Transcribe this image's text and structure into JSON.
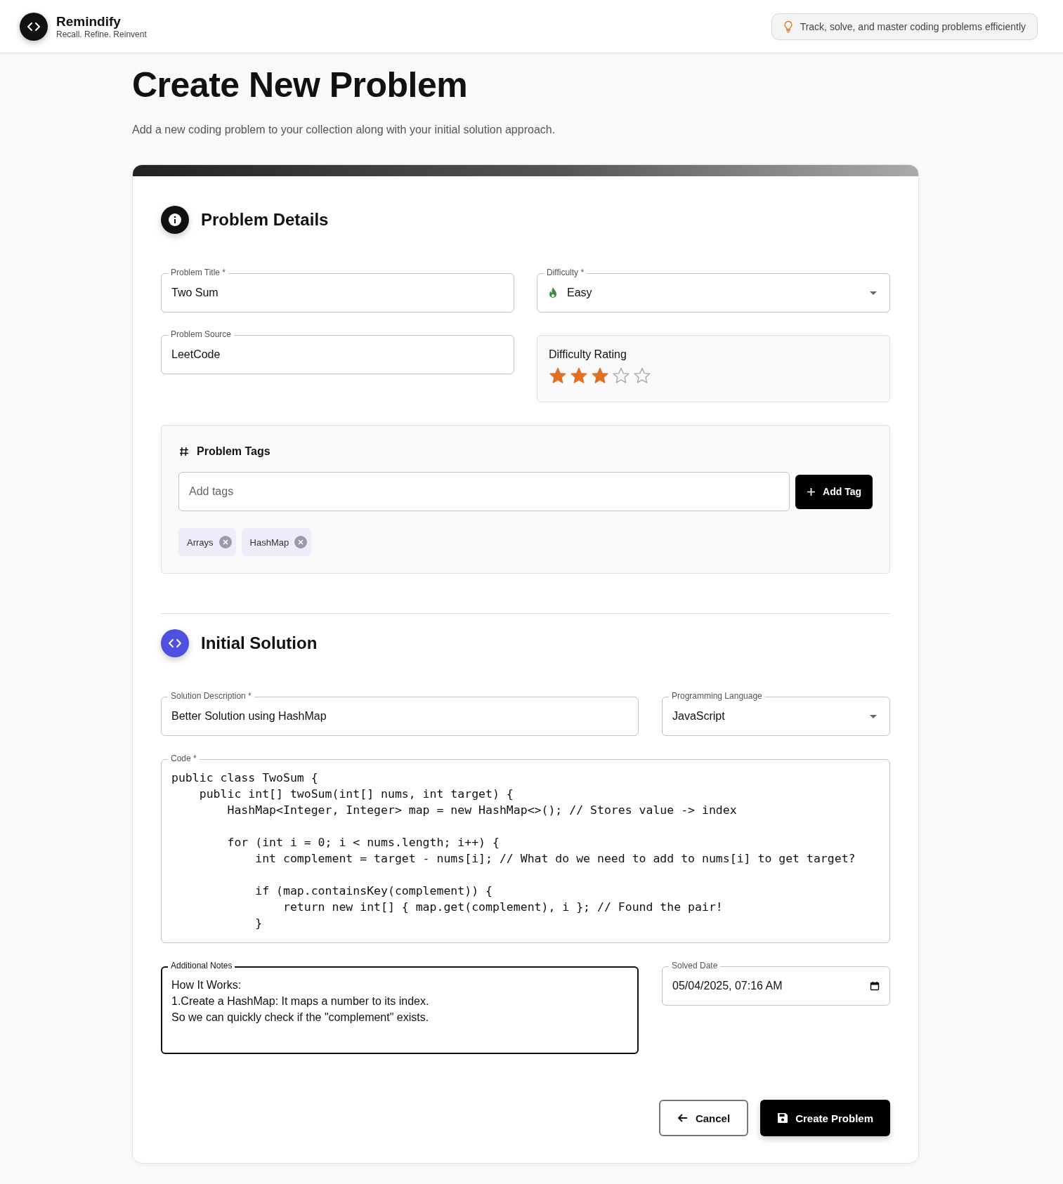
{
  "header": {
    "brand": "Remindify",
    "tagline": "Recall. Refine. Reinvent",
    "tip": "Track, solve, and master coding problems efficiently"
  },
  "page": {
    "title": "Create New Problem",
    "subtitle": "Add a new coding problem to your collection along with your initial solution approach."
  },
  "problem_details": {
    "heading": "Problem Details",
    "title_field": {
      "label": "Problem Title *",
      "value": "Two Sum"
    },
    "difficulty": {
      "label": "Difficulty *",
      "value": "Easy"
    },
    "source_field": {
      "label": "Problem Source",
      "value": "LeetCode"
    },
    "rating": {
      "label": "Difficulty Rating",
      "stars": 3
    },
    "tags": {
      "heading": "Problem Tags",
      "placeholder": "Add tags",
      "button": "Add Tag",
      "items": [
        {
          "label": "Arrays"
        },
        {
          "label": "HashMap"
        }
      ]
    }
  },
  "initial_solution": {
    "heading": "Initial Solution",
    "description": {
      "label": "Solution Description *",
      "value": "Better Solution using HashMap"
    },
    "language": {
      "label": "Programming Language",
      "value": "JavaScript"
    },
    "code": {
      "label": "Code *",
      "value": "public class TwoSum {\n    public int[] twoSum(int[] nums, int target) {\n        HashMap<Integer, Integer> map = new HashMap<>(); // Stores value -> index\n\n        for (int i = 0; i < nums.length; i++) {\n            int complement = target - nums[i]; // What do we need to add to nums[i] to get target?\n\n            if (map.containsKey(complement)) {\n                return new int[] { map.get(complement), i }; // Found the pair!\n            }"
    },
    "notes": {
      "label": "Additional Notes",
      "focused": true,
      "value": "How It Works:\n1.Create a HashMap: It maps a number to its index.\nSo we can quickly check if the \"complement\" exists."
    },
    "solved_date": {
      "label": "Solved Date",
      "value": "05/04/2025, 07:16 AM"
    }
  },
  "actions": [
    {
      "kind": "secondary",
      "label": "Cancel"
    },
    {
      "kind": "primary",
      "label": "Create Problem"
    }
  ]
}
